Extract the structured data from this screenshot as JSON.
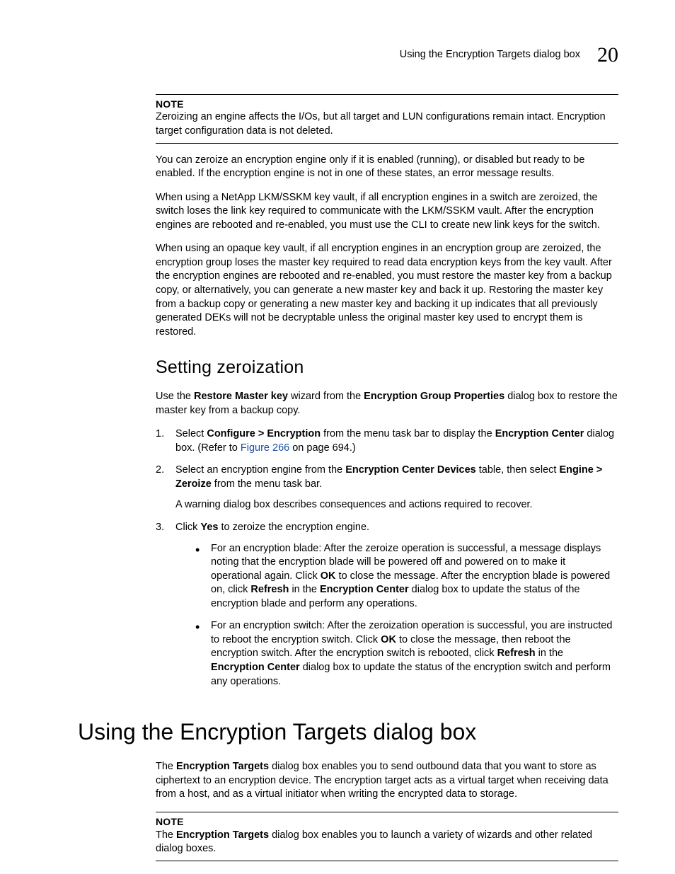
{
  "header": {
    "running_title": "Using the Encryption Targets dialog box",
    "chapter_number": "20"
  },
  "note1": {
    "label": "NOTE",
    "text_parts": [
      "Zeroizing an engine affects the I/Os, but all target and LUN configurations remain intact. Encryption target configuration data is not deleted."
    ]
  },
  "para1": "You can zeroize an encryption engine only if it is enabled (running), or disabled but ready to be enabled. If the encryption engine is not in one of these states, an error message results.",
  "para2": "When using a NetApp LKM/SSKM key vault, if all encryption engines in a switch are zeroized, the switch loses the link key required to communicate with the LKM/SSKM vault. After the encryption engines are rebooted and re-enabled, you must use the CLI to create new link keys for the switch.",
  "para3": "When using an opaque key vault, if all encryption engines in an encryption group are zeroized, the encryption group loses the master key required to read data encryption keys from the key vault. After the encryption engines are rebooted and re-enabled, you must restore the master key from a backup copy, or alternatively, you can generate a new master key and back it up. Restoring the master key from a backup copy or generating a new master key and backing it up indicates that all previously generated DEKs will not be decryptable unless the original master key used to encrypt them is restored.",
  "section_heading": "Setting zeroization",
  "intro": {
    "t1": "Use the ",
    "b1": "Restore Master key",
    "t2": " wizard from the ",
    "b2": "Encryption Group Properties",
    "t3": " dialog box to restore the master key from a backup copy."
  },
  "step1": {
    "t1": "Select ",
    "b1": "Configure > Encryption",
    "t2": " from the menu task bar to display the ",
    "b2": "Encryption Center",
    "t3": " dialog box. (Refer to ",
    "link": "Figure 266",
    "t4": " on page 694.)"
  },
  "step2": {
    "t1": "Select an encryption engine from the ",
    "b1": "Encryption Center Devices",
    "t2": " table, then select ",
    "b2": "Engine > Zeroize",
    "t3": " from the menu task bar.",
    "after": "A warning dialog box describes consequences and actions required to recover."
  },
  "step3": {
    "t1": "Click ",
    "b1": "Yes",
    "t2": " to zeroize the encryption engine."
  },
  "bullet1": {
    "t1": "For an encryption blade: After the zeroize operation is successful, a message displays noting that the encryption blade will be powered off and powered on to make it operational again. Click ",
    "b1": "OK",
    "t2": " to close the message. After the encryption blade is powered on, click ",
    "b2": "Refresh",
    "t3": " in the ",
    "b3": "Encryption Center",
    "t4": " dialog box to update the status of the encryption blade and perform any operations."
  },
  "bullet2": {
    "t1": "For an encryption switch: After the zeroization operation is successful, you are instructed to reboot the encryption switch. Click ",
    "b1": "OK",
    "t2": " to close the message, then reboot the encryption switch. After the encryption switch is rebooted, click ",
    "b2": "Refresh",
    "t3": " in the ",
    "b3": "Encryption Center",
    "t4": " dialog box to update the status of the encryption switch and perform any operations."
  },
  "chapter_heading": "Using the Encryption Targets dialog box",
  "chapter_para": {
    "t1": "The ",
    "b1": "Encryption Targets",
    "t2": " dialog box enables you to send outbound data that you want to store as ciphertext to an encryption device. The encryption target acts as a virtual target when receiving data from a host, and as a virtual initiator when writing the encrypted data to storage."
  },
  "note2": {
    "label": "NOTE",
    "t1": "The ",
    "b1": "Encryption Targets",
    "t2": " dialog box enables you to launch a variety of wizards and other related dialog boxes."
  }
}
